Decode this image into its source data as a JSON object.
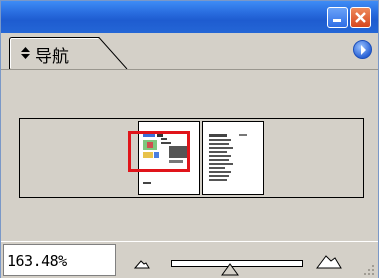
{
  "panel": {
    "tab_label": "导航",
    "tab_arrows_icon": "up-down-arrows-icon",
    "menu_icon": "panel-menu-arrow-icon"
  },
  "window_controls": {
    "minimize_icon": "minimize-icon",
    "close_icon": "close-icon"
  },
  "statusbar": {
    "zoom_value": "163.48%",
    "zoom_out_icon": "small-mountain-icon",
    "zoom_in_icon": "large-mountain-icon",
    "zoom_slider_level": 0.45
  },
  "colors": {
    "title_bar": "#2466d6",
    "panel_bg": "#d4d0c8",
    "view_box": "#e0141a"
  }
}
